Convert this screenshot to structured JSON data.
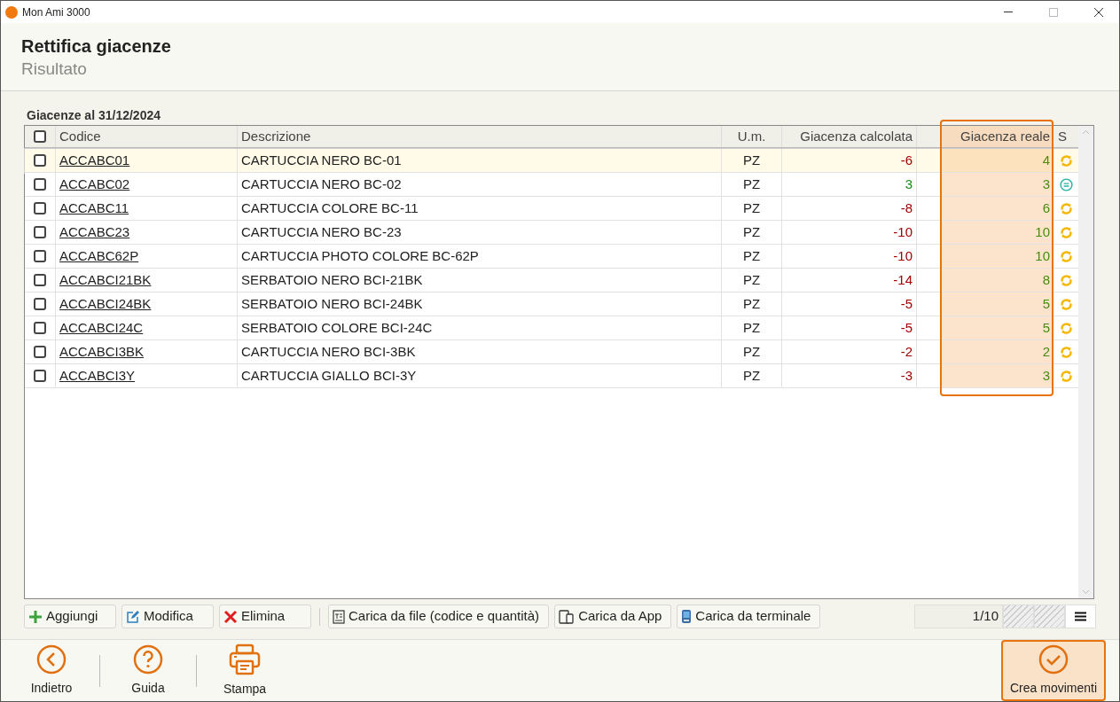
{
  "window": {
    "title": "Mon Ami 3000"
  },
  "header": {
    "title": "Rettifica giacenze",
    "subtitle": "Risultato"
  },
  "table": {
    "caption": "Giacenze al 31/12/2024",
    "columns": [
      "Codice",
      "Descrizione",
      "U.m.",
      "Giacenza calcolata",
      "Giacenza reale",
      "S"
    ],
    "all_checked": false,
    "rows": [
      {
        "code": "ACCABC01",
        "description": "CARTUCCIA NERO BC-01",
        "unit": "PZ",
        "calculated": "-6",
        "real": "4",
        "kind": "sync",
        "checked": false,
        "selected": true
      },
      {
        "code": "ACCABC02",
        "description": "CARTUCCIA NERO BC-02",
        "unit": "PZ",
        "calculated": "3",
        "real": "3",
        "kind": "equal",
        "checked": false,
        "selected": false
      },
      {
        "code": "ACCABC11",
        "description": "CARTUCCIA COLORE BC-11",
        "unit": "PZ",
        "calculated": "-8",
        "real": "6",
        "kind": "sync",
        "checked": false,
        "selected": false
      },
      {
        "code": "ACCABC23",
        "description": "CARTUCCIA NERO BC-23",
        "unit": "PZ",
        "calculated": "-10",
        "real": "10",
        "kind": "sync",
        "checked": false,
        "selected": false
      },
      {
        "code": "ACCABC62P",
        "description": "CARTUCCIA PHOTO COLORE BC-62P",
        "unit": "PZ",
        "calculated": "-10",
        "real": "10",
        "kind": "sync",
        "checked": false,
        "selected": false
      },
      {
        "code": "ACCABCI21BK",
        "description": "SERBATOIO NERO BCI-21BK",
        "unit": "PZ",
        "calculated": "-14",
        "real": "8",
        "kind": "sync",
        "checked": false,
        "selected": false
      },
      {
        "code": "ACCABCI24BK",
        "description": "SERBATOIO NERO BCI-24BK",
        "unit": "PZ",
        "calculated": "-5",
        "real": "5",
        "kind": "sync",
        "checked": false,
        "selected": false
      },
      {
        "code": "ACCABCI24C",
        "description": "SERBATOIO COLORE BCI-24C",
        "unit": "PZ",
        "calculated": "-5",
        "real": "5",
        "kind": "sync",
        "checked": false,
        "selected": false
      },
      {
        "code": "ACCABCI3BK",
        "description": "CARTUCCIA NERO BCI-3BK",
        "unit": "PZ",
        "calculated": "-2",
        "real": "2",
        "kind": "sync",
        "checked": false,
        "selected": false
      },
      {
        "code": "ACCABCI3Y",
        "description": "CARTUCCIA GIALLO BCI-3Y",
        "unit": "PZ",
        "calculated": "-3",
        "real": "3",
        "kind": "sync",
        "checked": false,
        "selected": false
      }
    ]
  },
  "toolbar": [
    {
      "kind": "add",
      "label": "Aggiungi"
    },
    {
      "kind": "edit",
      "label": "Modifica"
    },
    {
      "kind": "delete",
      "label": "Elimina"
    },
    {
      "kind": "file",
      "label": "Carica da file (codice e quantità)"
    },
    {
      "kind": "app",
      "label": "Carica da App"
    },
    {
      "kind": "terminal",
      "label": "Carica da terminale"
    }
  ],
  "pager": "1/10",
  "footer": {
    "actions": [
      {
        "kind": "back",
        "label": "Indietro"
      },
      {
        "kind": "help",
        "label": "Guida"
      },
      {
        "kind": "print",
        "label": "Stampa"
      }
    ],
    "primary": {
      "label": "Crea movimenti"
    }
  }
}
